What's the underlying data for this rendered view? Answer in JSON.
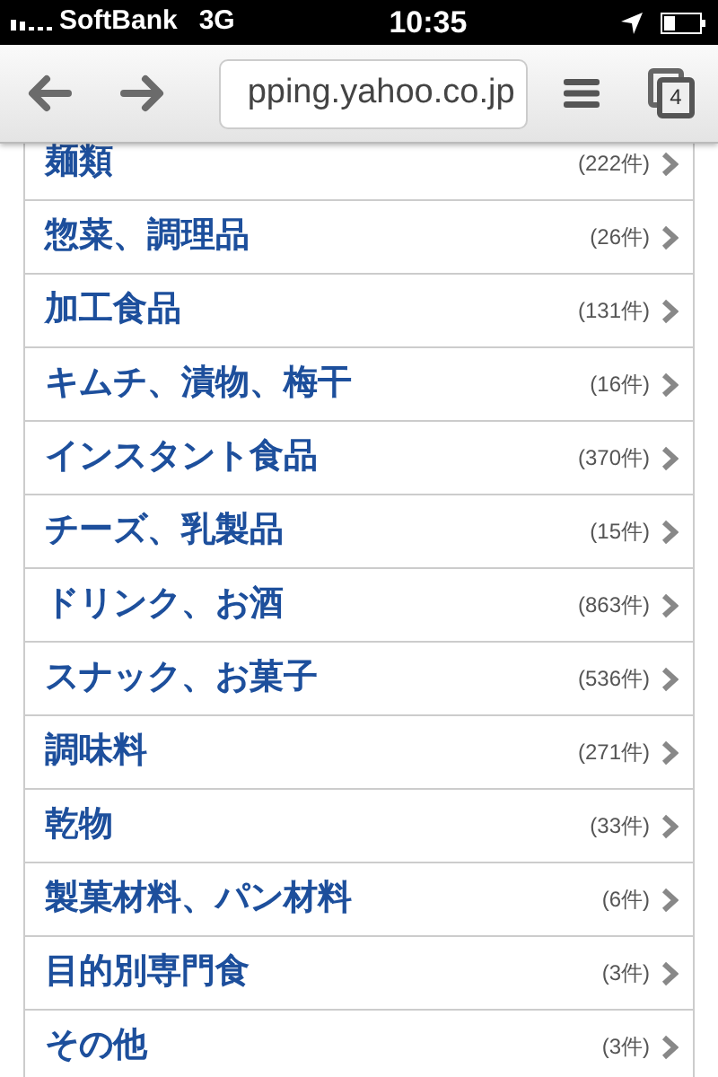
{
  "status_bar": {
    "carrier": "SoftBank",
    "network": "3G",
    "time": "10:35"
  },
  "toolbar": {
    "url": "pping.yahoo.co.jp",
    "tab_count": "4"
  },
  "categories": [
    {
      "name": "麺類",
      "count": "(222件)"
    },
    {
      "name": "惣菜、調理品",
      "count": "(26件)"
    },
    {
      "name": "加工食品",
      "count": "(131件)"
    },
    {
      "name": "キムチ、漬物、梅干",
      "count": "(16件)"
    },
    {
      "name": "インスタント食品",
      "count": "(370件)"
    },
    {
      "name": "チーズ、乳製品",
      "count": "(15件)"
    },
    {
      "name": "ドリンク、お酒",
      "count": "(863件)"
    },
    {
      "name": "スナック、お菓子",
      "count": "(536件)"
    },
    {
      "name": "調味料",
      "count": "(271件)"
    },
    {
      "name": "乾物",
      "count": "(33件)"
    },
    {
      "name": "製菓材料、パン材料",
      "count": "(6件)"
    },
    {
      "name": "目的別専門食",
      "count": "(3件)"
    },
    {
      "name": "その他",
      "count": "(3件)"
    }
  ]
}
